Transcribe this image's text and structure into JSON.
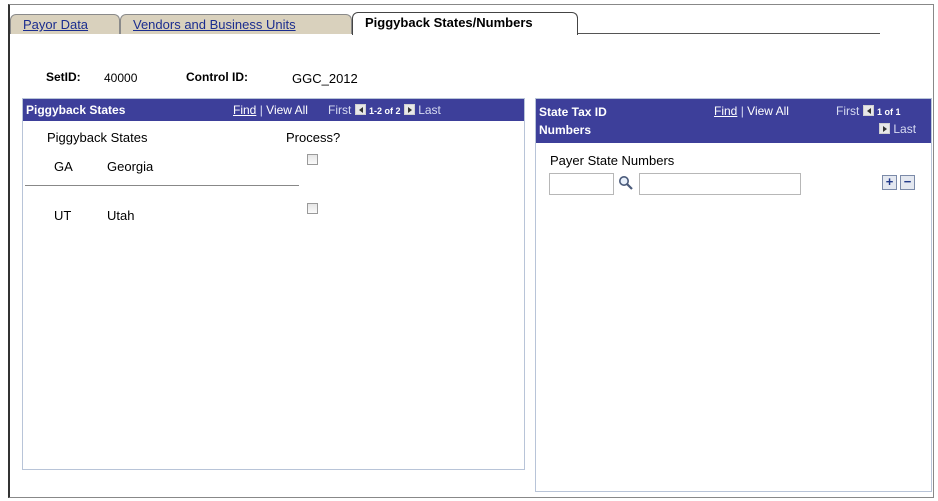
{
  "tabs": [
    {
      "label": "Payor Data"
    },
    {
      "label": "Vendors and Business Units"
    },
    {
      "label": "Piggyback States/Numbers"
    }
  ],
  "header": {
    "setid_label": "SetID:",
    "setid_value": "40000",
    "control_label": "Control ID:",
    "control_value": "GGC_2012"
  },
  "piggyback_grid": {
    "title": "Piggyback States",
    "find": "Find",
    "sep": "|",
    "view_all": "View All",
    "first": "First",
    "count": "1-2 of 2",
    "last": "Last",
    "col_states": "Piggyback States",
    "col_process": "Process?",
    "rows": [
      {
        "code": "GA",
        "name": "Georgia",
        "process": false
      },
      {
        "code": "UT",
        "name": "Utah",
        "process": false
      }
    ]
  },
  "tax_grid": {
    "title_line1": "State Tax ID",
    "title_line2": "Numbers",
    "find": "Find",
    "sep": "|",
    "view_all": "View All",
    "first": "First",
    "count": "1 of 1",
    "last": "Last",
    "col_payer": "Payer State Numbers",
    "state_value": "",
    "number_value": ""
  },
  "icons": {
    "lookup": "magnifier-icon",
    "add": "plus-icon",
    "delete": "minus-icon"
  },
  "colors": {
    "grid_header": "#3d3f9a",
    "tab_inactive": "#d9d1bd",
    "link": "#1b2d8f"
  }
}
